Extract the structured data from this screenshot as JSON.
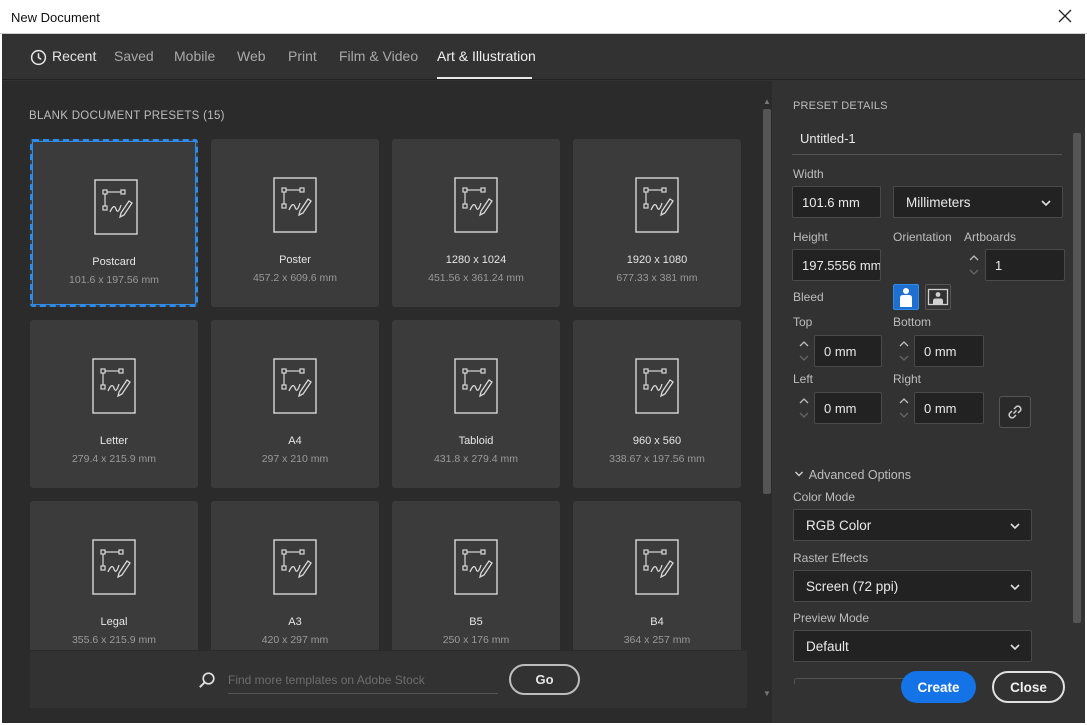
{
  "window": {
    "title": "New Document"
  },
  "tabs": [
    {
      "label": "Recent",
      "icon": "clock-icon"
    },
    {
      "label": "Saved"
    },
    {
      "label": "Mobile"
    },
    {
      "label": "Web"
    },
    {
      "label": "Print"
    },
    {
      "label": "Film & Video"
    },
    {
      "label": "Art & Illustration",
      "active": true
    }
  ],
  "presets": {
    "section_title": "BLANK DOCUMENT PRESETS",
    "count": "(15)",
    "items": [
      {
        "name": "Postcard",
        "dims": "101.6 x 197.56 mm",
        "selected": true
      },
      {
        "name": "Poster",
        "dims": "457.2 x 609.6 mm"
      },
      {
        "name": "1280 x 1024",
        "dims": "451.56 x 361.24 mm"
      },
      {
        "name": "1920 x 1080",
        "dims": "677.33 x 381 mm"
      },
      {
        "name": "Letter",
        "dims": "279.4 x 215.9 mm"
      },
      {
        "name": "A4",
        "dims": "297 x 210 mm"
      },
      {
        "name": "Tabloid",
        "dims": "431.8 x 279.4 mm"
      },
      {
        "name": "960 x 560",
        "dims": "338.67 x 197.56 mm"
      },
      {
        "name": "Legal",
        "dims": "355.6 x 215.9 mm"
      },
      {
        "name": "A3",
        "dims": "420 x 297 mm"
      },
      {
        "name": "B5",
        "dims": "250 x 176 mm"
      },
      {
        "name": "B4",
        "dims": "364 x 257 mm"
      }
    ]
  },
  "search": {
    "placeholder": "Find more templates on Adobe Stock",
    "go_label": "Go"
  },
  "details": {
    "heading": "PRESET DETAILS",
    "doc_name": "Untitled-1",
    "width_label": "Width",
    "width_value": "101.6 mm",
    "units": "Millimeters",
    "height_label": "Height",
    "height_value": "197.5556 mm",
    "orientation_label": "Orientation",
    "orientation": "portrait",
    "artboards_label": "Artboards",
    "artboards_value": "1",
    "bleed_label": "Bleed",
    "top_label": "Top",
    "top_value": "0 mm",
    "bottom_label": "Bottom",
    "bottom_value": "0 mm",
    "left_label": "Left",
    "left_value": "0 mm",
    "right_label": "Right",
    "right_value": "0 mm",
    "advanced_label": "Advanced Options",
    "color_mode_label": "Color Mode",
    "color_mode_value": "RGB Color",
    "raster_label": "Raster Effects",
    "raster_value": "Screen (72 ppi)",
    "preview_label": "Preview Mode",
    "preview_value": "Default"
  },
  "actions": {
    "create": "Create",
    "close": "Close"
  },
  "colors": {
    "accent": "#1473e6",
    "selection": "#2d8ceb",
    "panel": "#323232",
    "grid_bg": "#2b2b2b",
    "card": "#3b3b3b"
  }
}
